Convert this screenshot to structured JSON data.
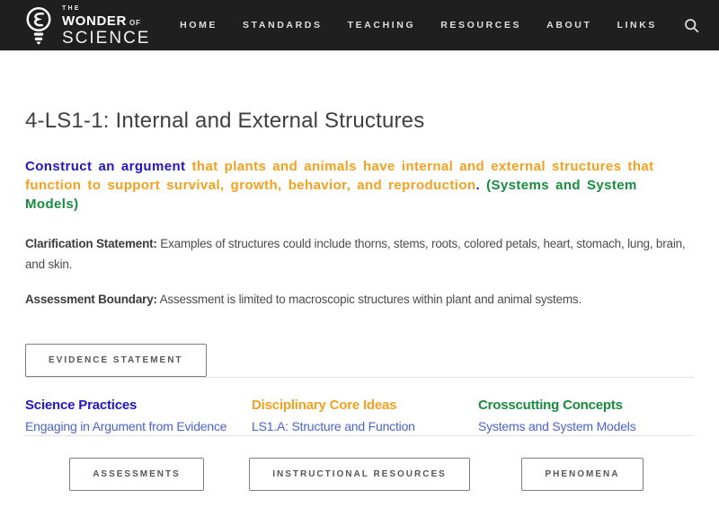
{
  "header": {
    "logo": {
      "the": "THE",
      "wonder": "WONDER",
      "of": "OF",
      "science": "SCIENCE"
    },
    "nav": [
      "HOME",
      "STANDARDS",
      "TEACHING",
      "RESOURCES",
      "ABOUT",
      "LINKS"
    ],
    "icons": {
      "logo": "lightbulb-icon",
      "search": "search-icon"
    }
  },
  "page": {
    "title": "4-LS1-1: Internal and External Structures",
    "performance_expectation": {
      "practice": "Construct an argument",
      "dci": " that plants and animals have internal and external structures that function to support survival, growth, behavior, and reproduction",
      "period": ".",
      "ccc": " (Systems and System Models)"
    },
    "clarification": {
      "label": "Clarification Statement:",
      "text": " Examples of structures could include thorns, stems, roots, colored petals, heart, stomach, lung, brain, and skin."
    },
    "assessment_boundary": {
      "label": "Assessment Boundary:",
      "text": " Assessment is limited to macroscopic structures within plant and animal systems."
    },
    "evidence_button": "EVIDENCE STATEMENT",
    "columns": [
      {
        "heading": "Science Practices",
        "link": "Engaging in Argument from Evidence"
      },
      {
        "heading": "Disciplinary Core Ideas",
        "link": "LS1.A: Structure and Function"
      },
      {
        "heading": "Crosscutting Concepts",
        "link": "Systems and System Models"
      }
    ],
    "bottom_buttons": [
      "ASSESSMENTS",
      "INSTRUCTIONAL RESOURCES",
      "PHENOMENA"
    ]
  },
  "colors": {
    "nav_background": "#1f1f1f",
    "practice_blue": "#2016c8",
    "dci_orange": "#f5a01e",
    "ccc_green": "#168c3c",
    "link_blue": "#4a62d2"
  }
}
